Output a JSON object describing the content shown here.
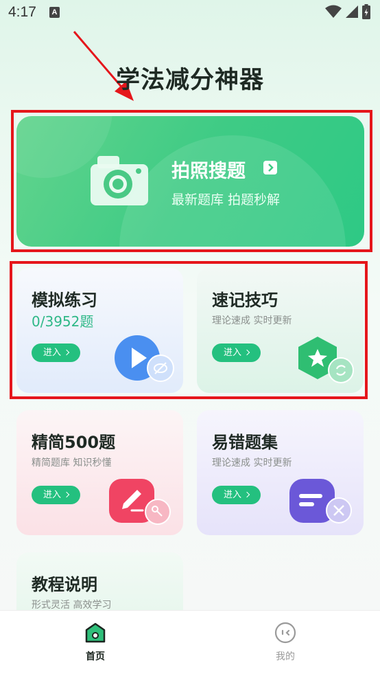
{
  "status_bar": {
    "time": "4:17",
    "notification_badge": "A"
  },
  "app": {
    "title": "学法减分神器"
  },
  "photo_search": {
    "title": "拍照搜题",
    "subtitle": "最新题库  拍题秒解"
  },
  "cards": [
    {
      "id": "mock",
      "title": "模拟练习",
      "progress": "0/3952题",
      "button": "进入"
    },
    {
      "id": "memo",
      "title": "速记技巧",
      "subtitle": "理论速成  实时更新",
      "button": "进入"
    },
    {
      "id": "simple",
      "title": "精简500题",
      "subtitle": "精简题库  知识秒懂",
      "button": "进入"
    },
    {
      "id": "wrong",
      "title": "易错题集",
      "subtitle": "理论速成  实时更新",
      "button": "进入"
    },
    {
      "id": "guide",
      "title": "教程说明",
      "subtitle": "形式灵活  高效学习"
    }
  ],
  "tabs": [
    {
      "label": "首页",
      "active": true
    },
    {
      "label": "我的",
      "active": false
    }
  ],
  "colors": {
    "accent": "#24c07f",
    "annotation": "#e5161b"
  }
}
